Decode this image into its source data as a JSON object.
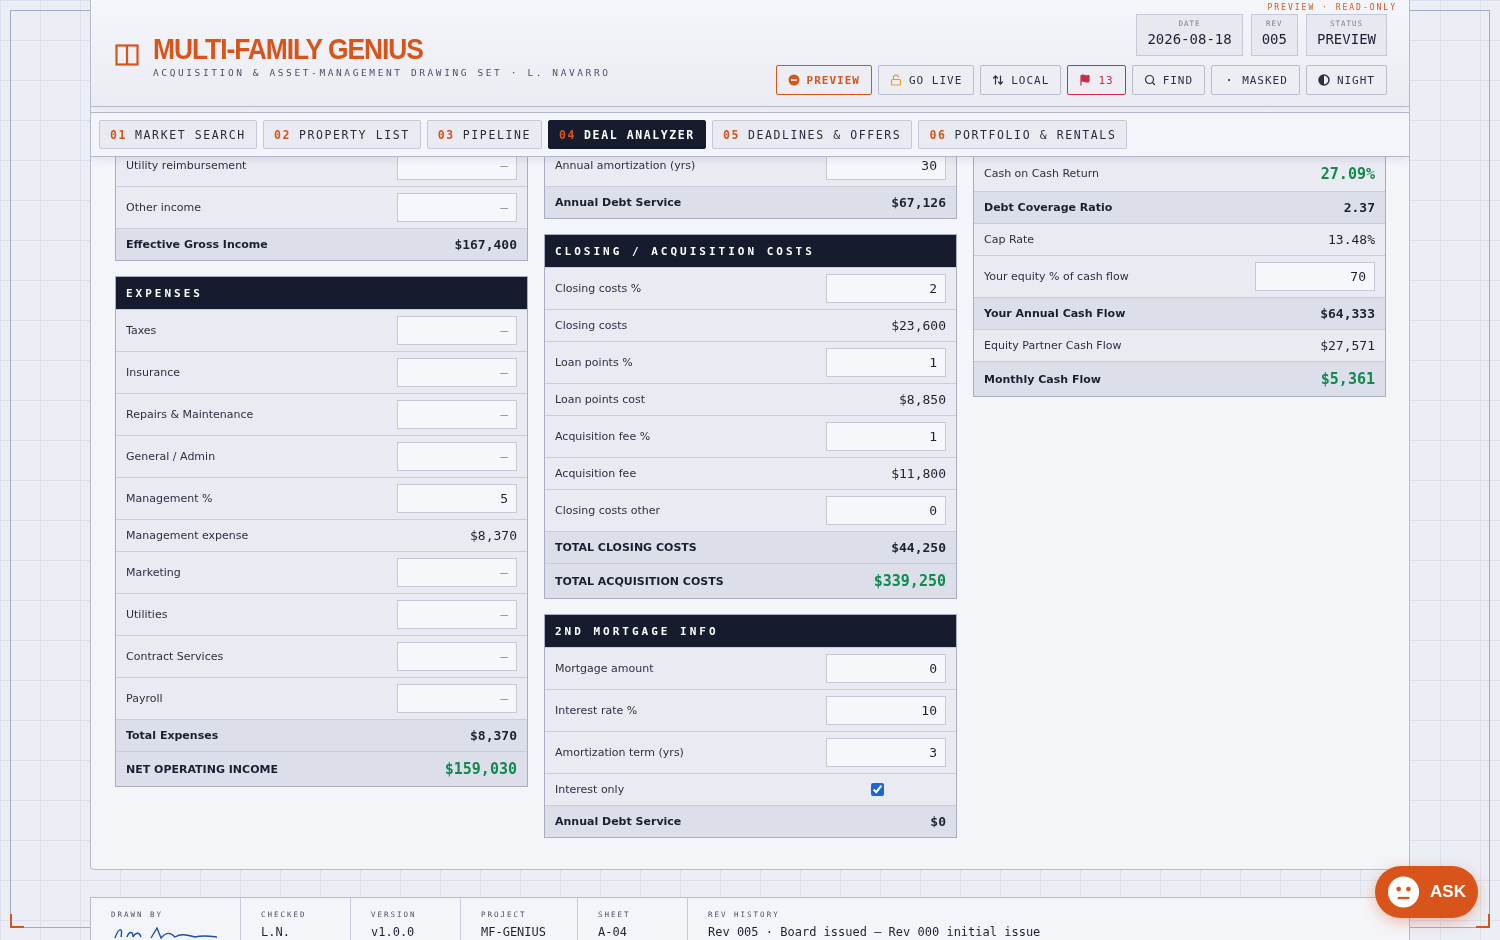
{
  "app": {
    "title": "MULTI-FAMILY GENIUS",
    "subtitle": "ACQUISITION & ASSET-MANAGEMENT DRAWING SET · L. NAVARRO",
    "mode_note": "PREVIEW · READ-ONLY"
  },
  "meta": [
    {
      "label": "DATE",
      "value": "2026-08-18"
    },
    {
      "label": "REV",
      "value": "005"
    },
    {
      "label": "STATUS",
      "value": "PREVIEW"
    }
  ],
  "toolbar": [
    {
      "label": "PREVIEW",
      "selected": true,
      "alert": false
    },
    {
      "label": "GO LIVE",
      "selected": false,
      "alert": false
    },
    {
      "label": "LOCAL",
      "selected": false,
      "alert": false
    },
    {
      "label": "13",
      "selected": false,
      "alert": true
    },
    {
      "label": "FIND",
      "selected": false,
      "alert": false
    },
    {
      "label": "MASKED",
      "selected": false,
      "alert": false
    },
    {
      "label": "NIGHT",
      "selected": false,
      "alert": false
    }
  ],
  "tabs": [
    {
      "number": "01",
      "label": "MARKET SEARCH",
      "selected": false
    },
    {
      "number": "02",
      "label": "PROPERTY LIST",
      "selected": false
    },
    {
      "number": "03",
      "label": "PIPELINE",
      "selected": false
    },
    {
      "number": "04",
      "label": "DEAL ANALYZER",
      "selected": true
    },
    {
      "number": "05",
      "label": "DEADLINES & OFFERS",
      "selected": false
    },
    {
      "number": "06",
      "label": "PORTFOLIO & RENTALS",
      "selected": false
    }
  ],
  "columns": [
    {
      "panels": [
        {
          "rows": [
            {
              "kind": "input",
              "label": "Utility reimbursement",
              "placeholder": "–"
            },
            {
              "kind": "input",
              "label": "Other income",
              "placeholder": "–"
            },
            {
              "kind": "value",
              "label": "Effective Gross Income",
              "value": "$167,400",
              "total": true
            }
          ]
        },
        {
          "title": "EXPENSES",
          "rows": [
            {
              "kind": "input",
              "label": "Taxes",
              "placeholder": "–"
            },
            {
              "kind": "input",
              "label": "Insurance",
              "placeholder": "–"
            },
            {
              "kind": "input",
              "label": "Repairs & Maintenance",
              "placeholder": "–"
            },
            {
              "kind": "input",
              "label": "General / Admin",
              "placeholder": "–"
            },
            {
              "kind": "input",
              "label": "Management %",
              "value": "5"
            },
            {
              "kind": "value",
              "label": "Management expense",
              "value": "$8,370"
            },
            {
              "kind": "input",
              "label": "Marketing",
              "placeholder": "–"
            },
            {
              "kind": "input",
              "label": "Utilities",
              "placeholder": "–"
            },
            {
              "kind": "input",
              "label": "Contract Services",
              "placeholder": "–"
            },
            {
              "kind": "input",
              "label": "Payroll",
              "placeholder": "–"
            },
            {
              "kind": "value",
              "label": "Total Expenses",
              "value": "$8,370",
              "total": true
            },
            {
              "kind": "value",
              "label": "NET OPERATING INCOME",
              "value": "$159,030",
              "total": true,
              "positive": true
            }
          ]
        }
      ]
    },
    {
      "panels": [
        {
          "rows": [
            {
              "kind": "input",
              "label": "Annual amortization (yrs)",
              "value": "30"
            },
            {
              "kind": "value",
              "label": "Annual Debt Service",
              "value": "$67,126",
              "total": true
            }
          ]
        },
        {
          "title": "CLOSING / ACQUISITION COSTS",
          "rows": [
            {
              "kind": "input",
              "label": "Closing costs %",
              "value": "2"
            },
            {
              "kind": "value",
              "label": "Closing costs",
              "value": "$23,600"
            },
            {
              "kind": "input",
              "label": "Loan points %",
              "value": "1"
            },
            {
              "kind": "value",
              "label": "Loan points cost",
              "value": "$8,850"
            },
            {
              "kind": "input",
              "label": "Acquisition fee %",
              "value": "1"
            },
            {
              "kind": "value",
              "label": "Acquisition fee",
              "value": "$11,800"
            },
            {
              "kind": "input",
              "label": "Closing costs other",
              "value": "0"
            },
            {
              "kind": "value",
              "label": "TOTAL CLOSING COSTS",
              "value": "$44,250",
              "total": true
            },
            {
              "kind": "value",
              "label": "TOTAL ACQUISITION COSTS",
              "value": "$339,250",
              "total": true,
              "positive": true
            }
          ]
        },
        {
          "title": "2ND MORTGAGE INFO",
          "rows": [
            {
              "kind": "input",
              "label": "Mortgage amount",
              "value": "0"
            },
            {
              "kind": "input",
              "label": "Interest rate %",
              "value": "10"
            },
            {
              "kind": "input",
              "label": "Amortization term (yrs)",
              "value": "3"
            },
            {
              "kind": "checkbox",
              "label": "Interest only",
              "checked": true
            },
            {
              "kind": "value",
              "label": "Annual Debt Service",
              "value": "$0",
              "total": true
            }
          ]
        }
      ]
    },
    {
      "panels": [
        {
          "rows": [
            {
              "kind": "value",
              "label": "Cash on Cash Return",
              "value": "27.09%",
              "positive": true
            },
            {
              "kind": "value",
              "label": "Debt Coverage Ratio",
              "value": "2.37",
              "total": true
            },
            {
              "kind": "value",
              "label": "Cap Rate",
              "value": "13.48%"
            },
            {
              "kind": "input",
              "label": "Your equity % of cash flow",
              "value": "70"
            },
            {
              "kind": "value",
              "label": "Your Annual Cash Flow",
              "value": "$64,333",
              "total": true
            },
            {
              "kind": "value",
              "label": "Equity Partner Cash Flow",
              "value": "$27,571"
            },
            {
              "kind": "value",
              "label": "Monthly Cash Flow",
              "value": "$5,361",
              "total": true,
              "positive": true
            }
          ]
        }
      ]
    }
  ],
  "title_block": [
    {
      "label": "DRAWN BY",
      "kind": "signature"
    },
    {
      "label": "CHECKED",
      "value": "L.N."
    },
    {
      "label": "VERSION",
      "value": "v1.0.0"
    },
    {
      "label": "PROJECT",
      "value": "MF-GENIUS"
    },
    {
      "label": "SHEET",
      "value": "A-04"
    },
    {
      "label": "REV HISTORY",
      "value": "Rev 005 · Board issued — Rev 000 initial issue"
    }
  ],
  "assistant": {
    "label": "ASK"
  }
}
